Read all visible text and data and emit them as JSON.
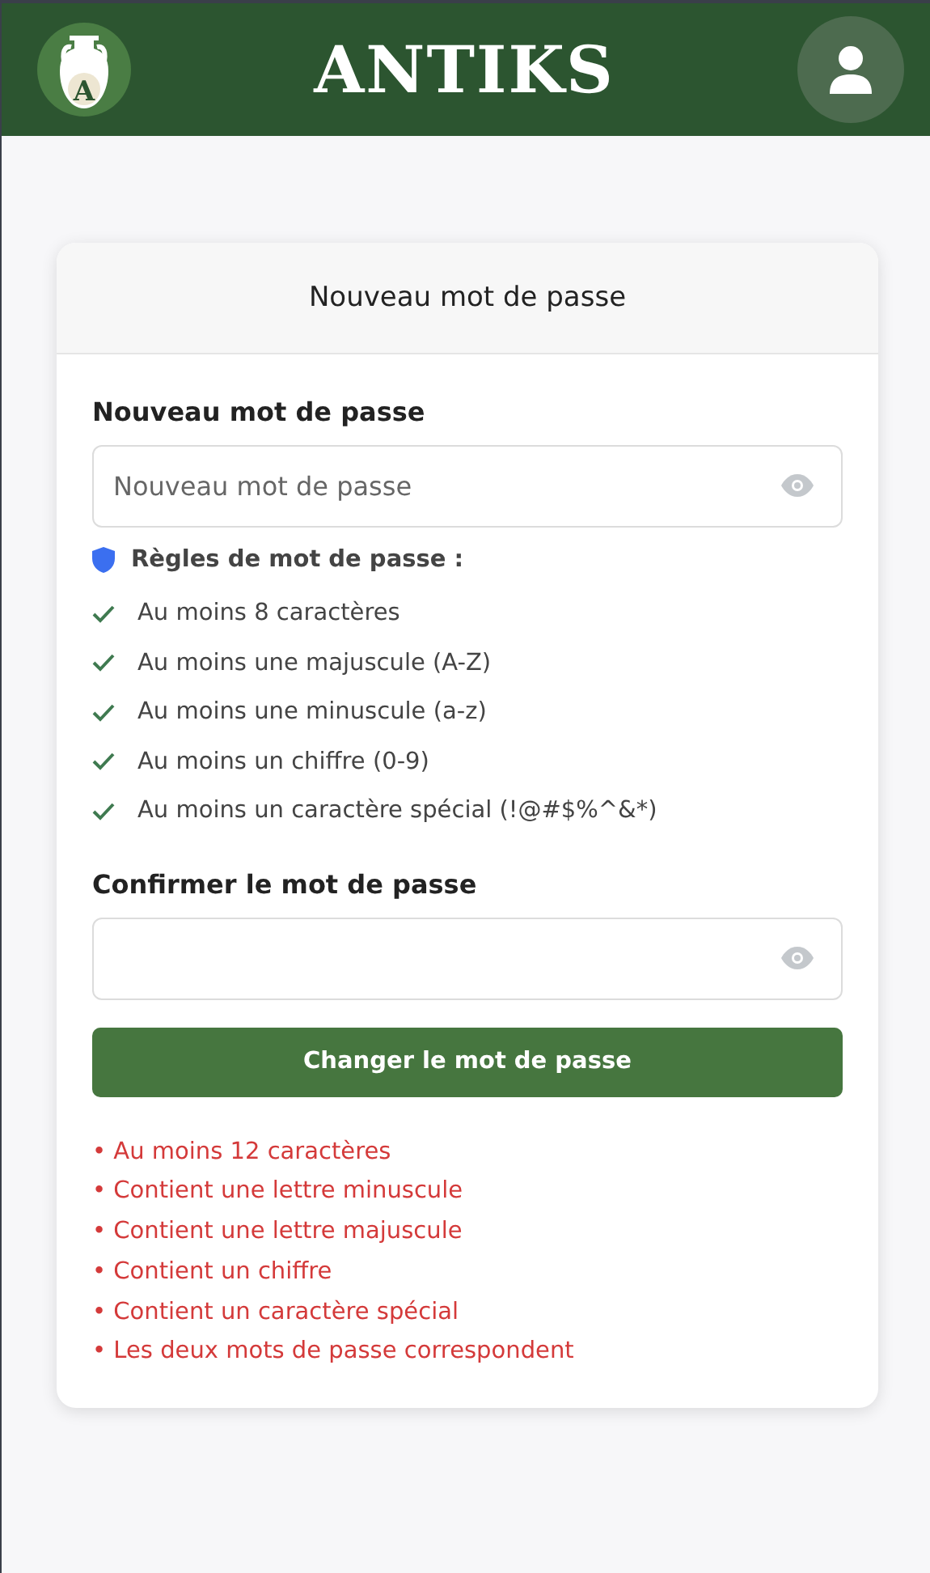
{
  "header": {
    "logo_letter": "A",
    "brand": "ANTIKS"
  },
  "card": {
    "title": "Nouveau mot de passe",
    "new_password": {
      "label": "Nouveau mot de passe",
      "placeholder": "Nouveau mot de passe"
    },
    "rules_title": "Règles de mot de passe :",
    "rules": [
      {
        "text": "Au moins 8 caractères",
        "met": true
      },
      {
        "text": "Au moins une majuscule (A-Z)",
        "met": true
      },
      {
        "text": "Au moins une minuscule (a-z)",
        "met": true
      },
      {
        "text": "Au moins un chiffre (0-9)",
        "met": true
      },
      {
        "text": "Au moins un caractère spécial (!@#$%^&*)",
        "met": true
      }
    ],
    "confirm_password": {
      "label": "Confirmer le mot de passe"
    },
    "submit": "Changer le mot de passe",
    "errors": [
      "• Au moins 12 caractères",
      "• Contient une lettre minuscule",
      "• Contient une lettre majuscule",
      "• Contient un chiffre",
      "• Contient un caractère spécial",
      "• Les deux mots de passe correspondent"
    ]
  }
}
